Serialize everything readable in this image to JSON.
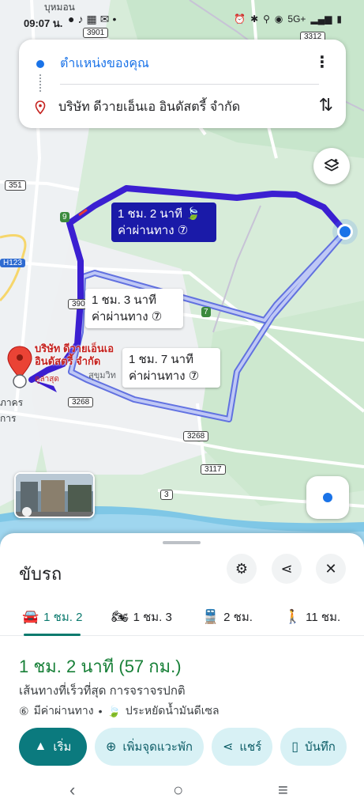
{
  "status": {
    "time": "09:07 น.",
    "left_icons": [
      "chat-icon",
      "tiktok-icon",
      "map-icon",
      "mail-icon",
      "dot-icon"
    ],
    "right_text": "5G+",
    "battery": "▮"
  },
  "search": {
    "origin": "ตำแหน่งของคุณ",
    "destination": "บริษัท ดีวายเอ็นเอ อินดัสตรี้ จำกัด"
  },
  "map": {
    "road_labels": [
      "3901",
      "3312",
      "351",
      "H123",
      "390",
      "3268",
      "3268",
      "3117",
      "3",
      "9",
      "7"
    ],
    "top_partial_label": "บุหมอน",
    "place_label_1": "ภาคร",
    "place_label_2": "การ",
    "street_label": "สุขุมวิท",
    "dest_label_line1": "บริษัท ดีวายเอ็นเอ",
    "dest_label_line2": "อินดัสตรี้ จำกัด",
    "dest_sub": "ดูล่าสุด",
    "routes": [
      {
        "time": "1 ชม. 2 นาที",
        "toll": "ค่าผ่านทาง",
        "selected": true
      },
      {
        "time": "1 ชม. 3 นาที",
        "toll": "ค่าผ่านทาง",
        "selected": false
      },
      {
        "time": "1 ชม. 7 นาที",
        "toll": "ค่าผ่านทาง",
        "selected": false
      }
    ]
  },
  "sheet": {
    "title": "ขับรถ",
    "modes": [
      {
        "icon": "car-icon",
        "label": "1 ชม. 2",
        "active": true
      },
      {
        "icon": "motorcycle-icon",
        "label": "1 ชม. 3",
        "active": false
      },
      {
        "icon": "transit-icon",
        "label": "2 ชม.",
        "active": false
      },
      {
        "icon": "walk-icon",
        "label": "11 ชม.",
        "active": false
      }
    ],
    "summary_time": "1 ชม. 2 นาที",
    "summary_distance": "(57 กม.)",
    "description": "เส้นทางที่เร็วที่สุด การจราจรปกติ",
    "toll_note": "มีค่าผ่านทาง",
    "separator": "•",
    "eco_note": "ประหยัดน้ำมันดีเซล",
    "actions": {
      "start": "เริ่ม",
      "add_stop": "เพิ่มจุดแวะพัก",
      "share": "แชร์",
      "save": "บันทึก"
    }
  },
  "colors": {
    "selected_route": "#3b1fd1",
    "alt_route": "#a8b4f0",
    "accent": "#0b7a7e",
    "summary_green": "#188038"
  }
}
